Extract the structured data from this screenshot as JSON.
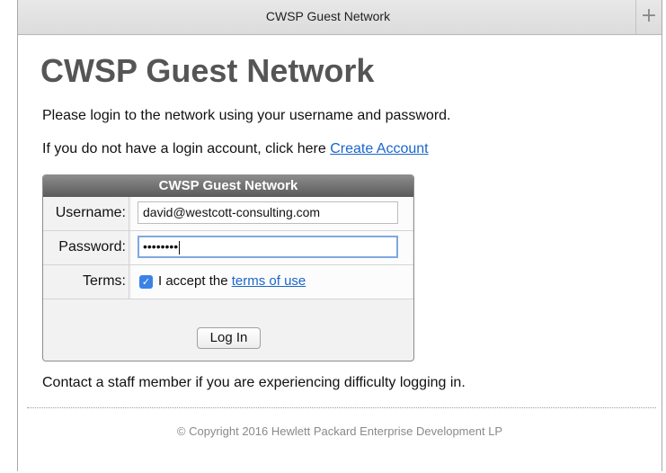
{
  "tab": {
    "title": "CWSP Guest Network",
    "new_tab_icon": "+"
  },
  "page": {
    "heading": "CWSP Guest Network",
    "intro": "Please login to the network using your username and password.",
    "no_account_text": "If you do not have a login account, click here ",
    "create_account_link": "Create Account"
  },
  "login_form": {
    "header": "CWSP Guest Network",
    "username_label": "Username:",
    "username_value": "david@westcott-consulting.com",
    "password_label": "Password:",
    "password_masked": "••••••••",
    "terms_label": "Terms:",
    "terms_checked": true,
    "terms_text": "I accept the ",
    "terms_link": "terms of use",
    "login_button": "Log In"
  },
  "help_text": "Contact a staff member if you are experiencing difficulty logging in.",
  "footer": {
    "copyright": "© Copyright 2016 Hewlett Packard Enterprise Development LP"
  },
  "colors": {
    "accent": "#3b82e6",
    "link": "#1a66cc",
    "header_bar": "#6e6e6e"
  }
}
